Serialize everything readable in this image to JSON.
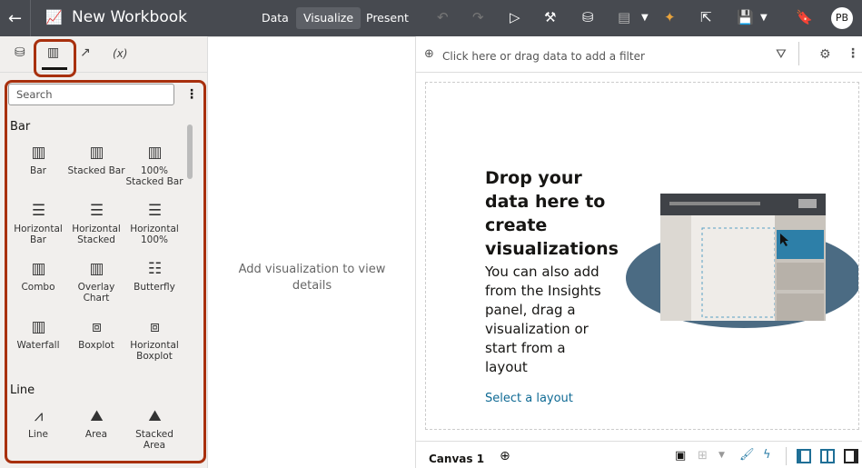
{
  "header": {
    "title": "New Workbook",
    "nav": [
      "Data",
      "Visualize",
      "Present"
    ],
    "active_nav": "Visualize",
    "avatar": "PB"
  },
  "left_panel": {
    "tabs": [
      "data-icon",
      "visualizations-icon",
      "analytics-icon",
      "(x)"
    ],
    "search_placeholder": "Search",
    "groups": [
      {
        "label": "Bar",
        "items": [
          "Bar",
          "Stacked Bar",
          "100% Stacked Bar",
          "Horizontal Bar",
          "Horizontal Stacked",
          "Horizontal 100%",
          "Combo",
          "Overlay Chart",
          "Butterfly",
          "Waterfall",
          "Boxplot",
          "Horizontal Boxplot"
        ]
      },
      {
        "label": "Line",
        "items": [
          "Line",
          "Area",
          "Stacked Area"
        ]
      }
    ]
  },
  "middle": {
    "message": "Add visualization to view details"
  },
  "filter_bar": {
    "placeholder": "Click here or drag data to add a filter"
  },
  "canvas": {
    "heading": "Drop your data here to create visualizations",
    "body": "You can also add from the Insights panel, drag a visualization or start from a layout",
    "link": "Select a layout"
  },
  "bottom": {
    "tab": "Canvas 1"
  },
  "colors": {
    "header": "#474a50",
    "highlight": "#a8300e",
    "link": "#0f6a94"
  }
}
